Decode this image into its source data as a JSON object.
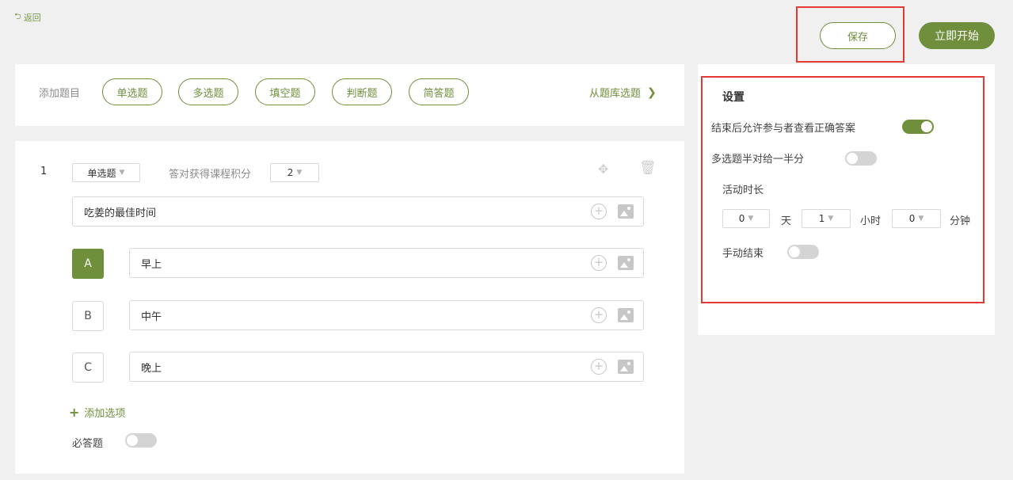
{
  "header": {
    "back_label": "返回",
    "save_label": "保存",
    "start_label": "立即开始"
  },
  "question_types": {
    "label": "添加题目",
    "types": [
      "单选题",
      "多选题",
      "填空题",
      "判断题",
      "简答题"
    ],
    "from_bank_label": "从题库选题"
  },
  "question": {
    "number": "1",
    "type": "单选题",
    "points_label": "答对获得课程积分",
    "points_value": "2",
    "title": "吃姜的最佳时间",
    "options": [
      {
        "letter": "A",
        "text": "早上",
        "selected": true
      },
      {
        "letter": "B",
        "text": "中午",
        "selected": false
      },
      {
        "letter": "C",
        "text": "晚上",
        "selected": false
      }
    ],
    "add_option_label": "添加选项",
    "required_label": "必答题",
    "required": false
  },
  "settings": {
    "title": "设置",
    "show_answers_label": "结束后允许参与者查看正确答案",
    "show_answers": true,
    "half_score_label": "多选题半对给一半分",
    "half_score": false,
    "duration_label": "活动时长",
    "days_value": "0",
    "days_unit": "天",
    "hours_value": "1",
    "hours_unit": "小时",
    "minutes_value": "0",
    "minutes_unit": "分钟",
    "manual_end_label": "手动结束",
    "manual_end": false
  },
  "colors": {
    "accent": "#6f8f3c",
    "highlight": "#e53935"
  }
}
